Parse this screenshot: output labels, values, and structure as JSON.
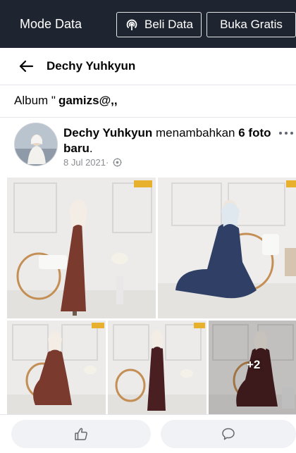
{
  "databar": {
    "mode_label": "Mode Data",
    "buy_label": "Beli Data",
    "free_label": "Buka Gratis"
  },
  "header": {
    "title": "Dechy Yuhkyun"
  },
  "album": {
    "prefix": "Album \"",
    "name": "gamizs@,,"
  },
  "post": {
    "author": "Dechy Yuhkyun",
    "action": " menambahkan ",
    "count": "6",
    "object": "foto baru",
    "punct": ".",
    "date": "8 Jul 2021",
    "separator": " · ",
    "more_photos": "+2"
  },
  "icons": {
    "back": "arrow-left-icon",
    "data": "wifi-signal-icon",
    "privacy": "globe-icon",
    "more": "more-horizontal-icon",
    "like": "thumbs-up-icon",
    "comment": "comment-icon"
  },
  "colors": {
    "databar_bg": "#1f2530",
    "divider": "#e4e6eb",
    "action_bg": "#f0f2f5",
    "dress_brown": "#7a3b2e",
    "dress_navy": "#2f3f66",
    "dress_maroon": "#4a1f22"
  }
}
